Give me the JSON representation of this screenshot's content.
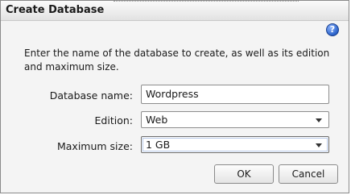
{
  "dialog": {
    "title": "Create Database",
    "help_icon": "help-icon",
    "help_glyph": "?",
    "instructions": "Enter the name of the database to create, as well as its edition and maximum size."
  },
  "form": {
    "name_label": "Database name:",
    "name_value": "Wordpress",
    "edition_label": "Edition:",
    "edition_value": "Web",
    "size_label": "Maximum size:",
    "size_value": "1 GB"
  },
  "buttons": {
    "ok_label": "OK",
    "cancel_label": "Cancel"
  },
  "colors": {
    "dialog_background": "#f4f4f4",
    "help_icon": "#2a62c9"
  }
}
